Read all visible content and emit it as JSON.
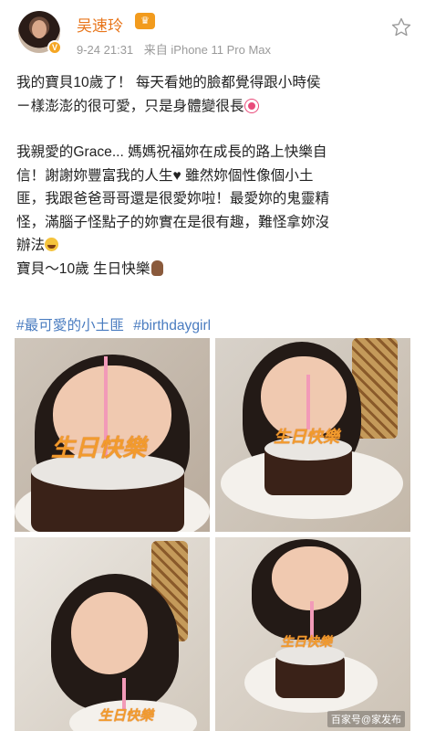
{
  "header": {
    "username": "吴速玲",
    "vip_badge_icon": "vip-crown-icon",
    "verified_icon": "verified-badge-icon",
    "timestamp": "9-24 21:31",
    "source": "来自 iPhone 11 Pro Max",
    "follow_icon": "star-outline-icon"
  },
  "post": {
    "paragraph1_line1": "我的寶貝10歲了！ 每天看她的臉都覺得跟小時侯",
    "paragraph1_line2": "ㄧ樣澎澎的很可愛，只是身體變很長",
    "paragraph2_line1": "我親愛的Grace... 媽媽祝福妳在成長的路上快樂自",
    "paragraph2_line2": "信！謝謝妳豐富我的人生♥ 雖然妳個性像個小土",
    "paragraph2_line3": "匪，我跟爸爸哥哥還是很愛妳啦！最愛妳的鬼靈精",
    "paragraph2_line4": "怪，滿腦子怪點子的妳實在是很有趣，難怪拿妳沒",
    "paragraph2_line5": "辦法",
    "paragraph3": "寶貝～10歲 生日快樂"
  },
  "hashtags": [
    "#最可愛的小土匪",
    "#birthdaygirl"
  ],
  "photos": {
    "topper_text": "生日快樂",
    "count": 4
  },
  "watermark": "百家号@家发布"
}
